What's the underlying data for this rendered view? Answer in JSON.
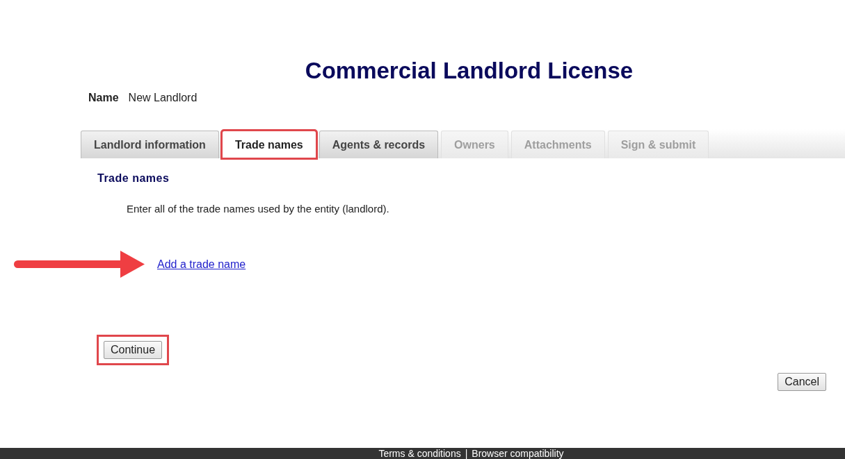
{
  "page": {
    "title": "Commercial Landlord License"
  },
  "name_field": {
    "label": "Name",
    "value": "New Landlord"
  },
  "tabs": [
    {
      "label": "Landlord information",
      "selected": false,
      "disabled": false,
      "highlighted": false
    },
    {
      "label": "Trade names",
      "selected": true,
      "disabled": false,
      "highlighted": true
    },
    {
      "label": "Agents & records",
      "selected": false,
      "disabled": false,
      "highlighted": false
    },
    {
      "label": "Owners",
      "selected": false,
      "disabled": true,
      "highlighted": false
    },
    {
      "label": "Attachments",
      "selected": false,
      "disabled": true,
      "highlighted": false
    },
    {
      "label": "Sign & submit",
      "selected": false,
      "disabled": true,
      "highlighted": false
    }
  ],
  "section": {
    "heading": "Trade names",
    "instructions": "Enter all of the trade names used by the entity (landlord).",
    "link": "Add a trade name",
    "link_arrow": true
  },
  "continue_button": {
    "label": "Continue",
    "highlighted": true
  },
  "cancel_button": {
    "label": "Cancel"
  },
  "footer": {
    "links": [
      "Terms & conditions",
      "Browser compatibility"
    ],
    "separator": "|"
  }
}
